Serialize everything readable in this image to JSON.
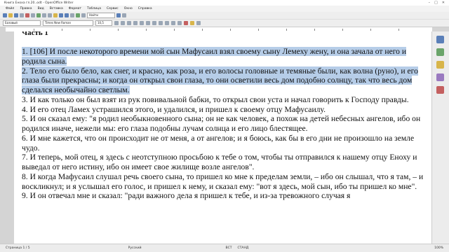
{
  "window": {
    "title": "Книга Еноха гл.20..odt - OpenOffice Writer"
  },
  "menu": [
    "Файл",
    "Правка",
    "Вид",
    "Вставка",
    "Формат",
    "Таблица",
    "Сервис",
    "Окно",
    "Справка"
  ],
  "toolbar": {
    "zoom": "Найти"
  },
  "format": {
    "style": "Базовый",
    "font": "Times New Roman",
    "size": "10,5"
  },
  "document": {
    "heading": "Часть 1",
    "paragraphs": [
      {
        "text": "1. [106] И после некоторого времени мой сын Мафусаил взял своему сыну Лемеху жену, и она зачала от него и родила сына.",
        "selected": true
      },
      {
        "text": "2. Тело его было бело, как снег, и красно, как роза, и его волосы головные и темяные были, как волна (руно), и его глаза были прекрасны; и когда он открыл свои глаза, то они осветили весь дом подобно солнцу, так что весь дом сделался необычайно светлым.",
        "selected": true
      },
      {
        "text": "3. И как только он был взят из рук повивальной бабки, то открыл свои уста и начал говорить к Господу правды.",
        "selected": false
      },
      {
        "text": "4. И его отец Ламех устрашился этого, и удалился, и пришел к своему отцу Мафусаилу.",
        "selected": false
      },
      {
        "text": "5. И он сказал ему: \"я родил необыкновенного сына; он не как человек, а похож на детей небесных ангелов, ибо он родился иначе, нежели мы: его глаза подобны лучам солнца и его лицо блестящее.",
        "selected": false
      },
      {
        "text": "6. И мне кажется, что он происходит не от меня, а от ангелов; и я боюсь, как бы в его дни не произошло на земле чудо.",
        "selected": false
      },
      {
        "text": "7. И теперь, мой отец, я здесь с неотступною просьбою к тебе о том, чтобы ты отправился к нашему отцу Еноху и выведал от него истину, ибо он имеет свое жилище возле ангелов\".",
        "selected": false
      },
      {
        "text": "8. И когда Мафусаил слушал речь своего сына, то пришел ко мне к пределам земли, – ибо он слышал, что я там, – и воскликнул; и я услышал его голос, и пришел к нему, и сказал ему: \"вот я здесь, мой сын, ибо ты пришел ко мне\".",
        "selected": false
      },
      {
        "text": "9. И он отвечал мне и сказал: \"ради важного дела я пришел к тебе, и из-за тревожного случая я",
        "selected": false
      }
    ]
  },
  "status": {
    "page": "Страница 1 / 5",
    "lang": "Русский",
    "mode": "ВСТ",
    "std": "СТАНД",
    "zoom": "100%"
  }
}
